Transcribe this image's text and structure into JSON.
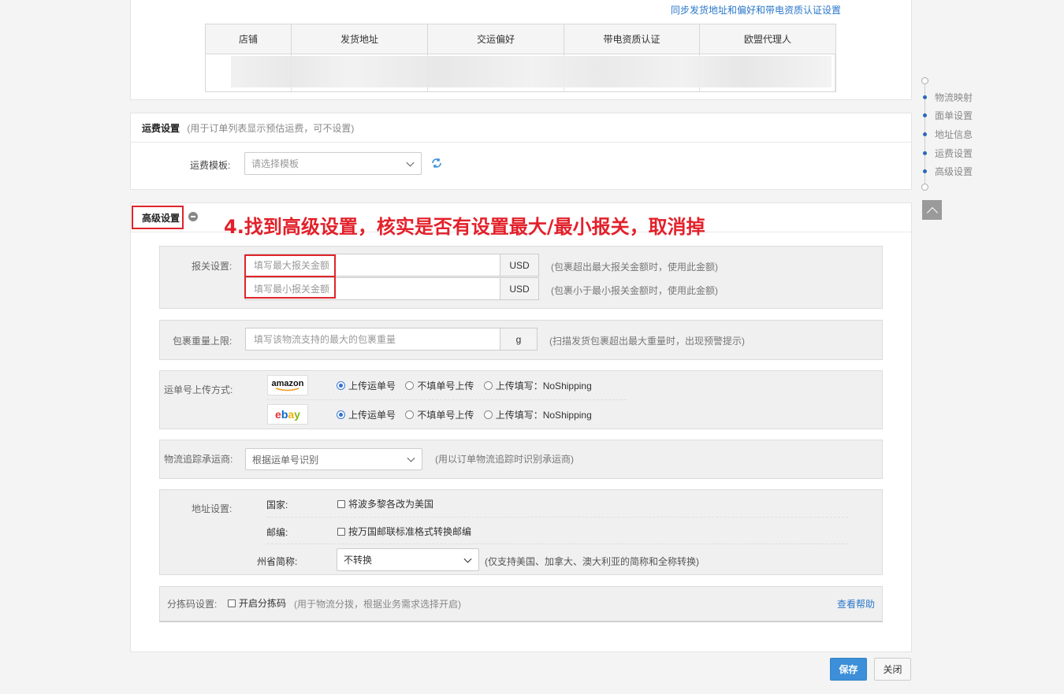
{
  "sync_link": "同步发货地址和偏好和带电资质认证设置",
  "store_table": {
    "headers": [
      "店铺",
      "发货地址",
      "交运偏好",
      "带电资质认证",
      "欧盟代理人"
    ]
  },
  "freight": {
    "title": "运费设置",
    "note": "(用于订单列表显示预估运费，可不设置)",
    "template_label": "运费模板:",
    "template_placeholder": "请选择模板"
  },
  "advanced": {
    "title": "高级设置",
    "annotation": "4.找到高级设置，核实是否有设置最大/最小报关，取消掉",
    "customs": {
      "label": "报关设置:",
      "max_placeholder": "填写最大报关金额",
      "min_placeholder": "填写最小报关金额",
      "currency": "USD",
      "max_hint": "(包裹超出最大报关金额时，使用此金额)",
      "min_hint": "(包裹小于最小报关金额时，使用此金额)"
    },
    "weight": {
      "label": "包裹重量上限:",
      "placeholder": "填写该物流支持的最大的包裹重量",
      "unit": "g",
      "hint": "(扫描发货包裹超出最大重量时，出现预警提示)"
    },
    "upload": {
      "label": "运单号上传方式:",
      "platforms": [
        {
          "logo": "amazon",
          "options": [
            "上传运单号",
            "不填单号上传",
            "上传填写：NoShipping"
          ],
          "selected": 0
        },
        {
          "logo": "ebay",
          "options": [
            "上传运单号",
            "不填单号上传",
            "上传填写：NoShipping"
          ],
          "selected": 0
        }
      ]
    },
    "carrier": {
      "label": "物流追踪承运商:",
      "value": "根据运单号识别",
      "hint": "(用以订单物流追踪时识别承运商)"
    },
    "address": {
      "label": "地址设置:",
      "country_label": "国家:",
      "country_option": "将波多黎各改为美国",
      "zip_label": "邮编:",
      "zip_option": "按万国邮联标准格式转换邮编",
      "state_label": "州省简称:",
      "state_value": "不转换",
      "state_hint": "(仅支持美国、加拿大、澳大利亚的简称和全称转换)"
    },
    "sort_code": {
      "label": "分拣码设置:",
      "option": "开启分拣码",
      "hint": "(用于物流分拨，根据业务需求选择开启)",
      "help": "查看帮助"
    }
  },
  "buttons": {
    "save": "保存",
    "close": "关闭"
  },
  "nav": {
    "items": [
      "物流映射",
      "面单设置",
      "地址信息",
      "运费设置",
      "高级设置"
    ]
  },
  "colors": {
    "accent": "#3c8fd8",
    "annotation_red": "#e3202a",
    "link": "#2a77c9"
  }
}
